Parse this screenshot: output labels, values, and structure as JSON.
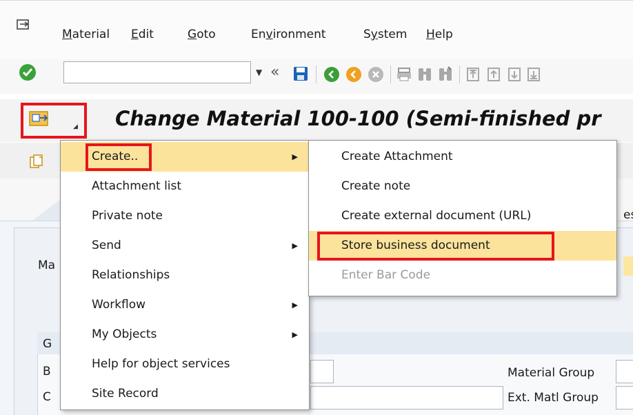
{
  "menubar": {
    "items": [
      {
        "pre": "",
        "u": "M",
        "post": "aterial"
      },
      {
        "pre": "",
        "u": "E",
        "post": "dit"
      },
      {
        "pre": "",
        "u": "G",
        "post": "oto"
      },
      {
        "pre": "En",
        "u": "v",
        "post": "ironment"
      },
      {
        "pre": "S",
        "u": "y",
        "post": "stem"
      },
      {
        "pre": "",
        "u": "H",
        "post": "elp"
      }
    ]
  },
  "toolbar": {
    "command_field": "",
    "icons": [
      "check-icon",
      "back-double-icon",
      "save-icon",
      "back-icon",
      "exit-icon",
      "cancel-icon",
      "print-icon",
      "find-icon",
      "find-next-icon",
      "first-page-icon",
      "prev-page-icon",
      "next-page-icon",
      "last-page-icon"
    ]
  },
  "title": "Change Material 100-100 (Semi-finished pr",
  "background": {
    "ma": "Ma",
    "g": "G",
    "b": "B",
    "c": "C",
    "material_group": "Material Group",
    "ext_matl_group": "Ext. Matl Group",
    "es": "es"
  },
  "menu_main": {
    "items": [
      {
        "label": "Create..",
        "submenu": true,
        "highlighted": true
      },
      {
        "label": "Attachment list",
        "submenu": false
      },
      {
        "label": "Private note",
        "submenu": false
      },
      {
        "label": "Send",
        "submenu": true
      },
      {
        "label": "Relationships",
        "submenu": false
      },
      {
        "label": "Workflow",
        "submenu": true
      },
      {
        "label": "My Objects",
        "submenu": true
      },
      {
        "label": "Help for object services",
        "submenu": false
      },
      {
        "label": "Site Record",
        "submenu": false
      }
    ]
  },
  "menu_create": {
    "items": [
      {
        "label": "Create Attachment"
      },
      {
        "label": "Create note"
      },
      {
        "label": "Create external document (URL)"
      },
      {
        "label": "Store business document",
        "highlighted": true
      },
      {
        "label": "Enter Bar Code",
        "disabled": true
      }
    ]
  },
  "colors": {
    "highlight": "#fbe39c",
    "annotation_red": "#e8141c",
    "disabled_text": "#9a9a9a"
  }
}
